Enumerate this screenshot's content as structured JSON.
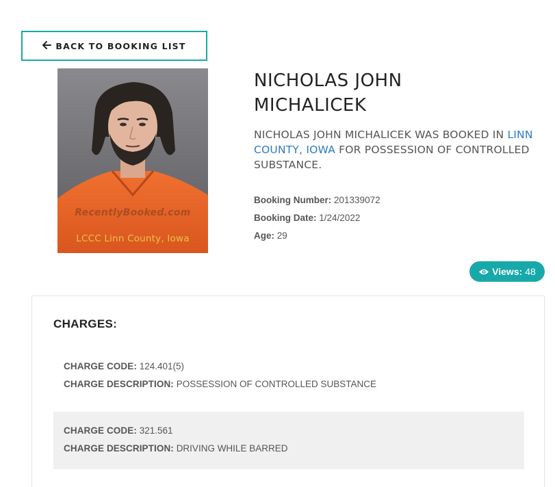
{
  "back_button": {
    "label": "BACK TO BOOKING LIST"
  },
  "mugshot": {
    "watermark_text": "RecentlyBooked.com",
    "caption": "LCCC Linn County, Iowa"
  },
  "person": {
    "name_line1": "NICHOLAS JOHN",
    "name_line2": "MICHALICEK",
    "summary_prefix": "NICHOLAS JOHN MICHALICEK WAS BOOKED IN",
    "summary_link": "LINN COUNTY, IOWA",
    "summary_suffix": "FOR POSSESSION OF CONTROLLED SUBSTANCE."
  },
  "details": {
    "booking_number_label": "Booking Number:",
    "booking_number": "201339072",
    "booking_date_label": "Booking Date:",
    "booking_date": "1/24/2022",
    "age_label": "Age:",
    "age": "29"
  },
  "views": {
    "icon": "eye-icon",
    "label": "Views:",
    "count": "48"
  },
  "charges": {
    "title": "CHARGES:",
    "items": [
      {
        "code_label": "CHARGE CODE:",
        "code": "124.401(5)",
        "description_label": "CHARGE DESCRIPTION:",
        "description": "POSSESSION OF CONTROLLED SUBSTANCE"
      },
      {
        "code_label": "CHARGE CODE:",
        "code": "321.561",
        "description_label": "CHARGE DESCRIPTION:",
        "description": "DRIVING WHILE BARRED"
      }
    ]
  },
  "colors": {
    "accent": "#17a9a9",
    "link": "#2d7ac2",
    "alt_row": "#f0f0f0"
  }
}
